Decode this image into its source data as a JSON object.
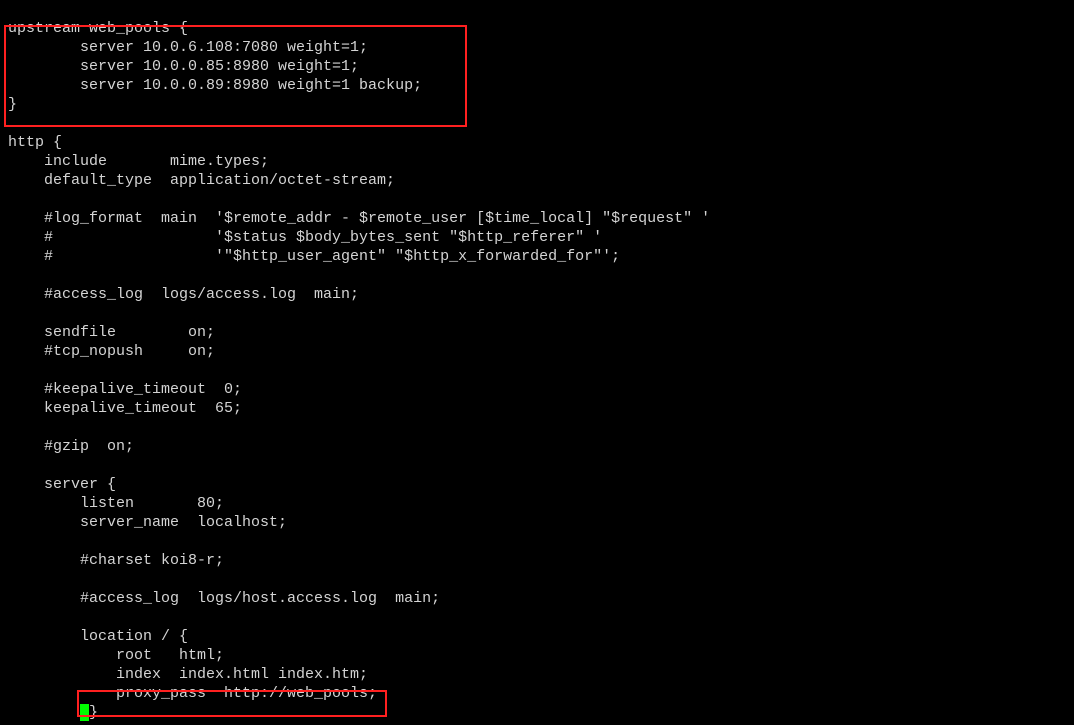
{
  "lines": {
    "l0": "",
    "l1": "upstream web_pools {",
    "l2": "        server 10.0.6.108:7080 weight=1;",
    "l3": "        server 10.0.0.85:8980 weight=1;",
    "l4": "        server 10.0.0.89:8980 weight=1 backup;",
    "l5": "}",
    "l6": "",
    "l7": "http {",
    "l8": "    include       mime.types;",
    "l9": "    default_type  application/octet-stream;",
    "l10": "",
    "l11": "    #log_format  main  '$remote_addr - $remote_user [$time_local] \"$request\" '",
    "l12": "    #                  '$status $body_bytes_sent \"$http_referer\" '",
    "l13": "    #                  '\"$http_user_agent\" \"$http_x_forwarded_for\"';",
    "l14": "",
    "l15": "    #access_log  logs/access.log  main;",
    "l16": "",
    "l17": "    sendfile        on;",
    "l18": "    #tcp_nopush     on;",
    "l19": "",
    "l20": "    #keepalive_timeout  0;",
    "l21": "    keepalive_timeout  65;",
    "l22": "",
    "l23": "    #gzip  on;",
    "l24": "",
    "l25": "    server {",
    "l26": "        listen       80;",
    "l27": "        server_name  localhost;",
    "l28": "",
    "l29": "        #charset koi8-r;",
    "l30": "",
    "l31": "        #access_log  logs/host.access.log  main;",
    "l32": "",
    "l33": "        location / {",
    "l34": "            root   html;",
    "l35": "            index  index.html index.htm;",
    "l36": "            proxy_pass  http://web_pools;",
    "l37a": "        ",
    "l37b": "}"
  }
}
